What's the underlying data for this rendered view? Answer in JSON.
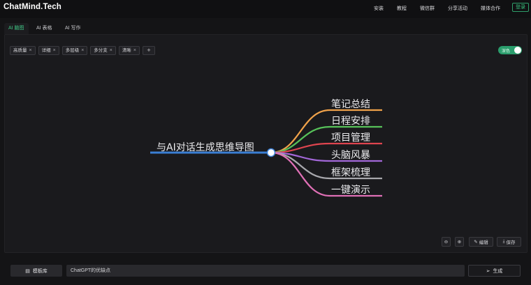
{
  "header": {
    "logo": "ChatMind.Tech",
    "nav": [
      "安装",
      "教程",
      "微信群",
      "分享活动",
      "媒体合作"
    ],
    "login_label": "登录"
  },
  "tabs": [
    {
      "label": "AI 脑图",
      "active": true
    },
    {
      "label": "AI 表格",
      "active": false
    },
    {
      "label": "AI 写作",
      "active": false
    }
  ],
  "tags": [
    "高质量",
    "详细",
    "多层级",
    "多分支",
    "清晰"
  ],
  "theme_toggle": {
    "label": "深色",
    "on": true
  },
  "mindmap": {
    "root": "与AI对话生成思维导图",
    "branches": [
      {
        "label": "笔记总结",
        "color": "#f0a24a"
      },
      {
        "label": "日程安排",
        "color": "#57c25a"
      },
      {
        "label": "项目管理",
        "color": "#e0454f"
      },
      {
        "label": "头脑风暴",
        "color": "#a267d8"
      },
      {
        "label": "框架梳理",
        "color": "#a8a8ad"
      },
      {
        "label": "一键演示",
        "color": "#e070b6"
      }
    ],
    "root_line_color": "#3b7fd4"
  },
  "controls": {
    "edit_label": "编辑",
    "save_label": "保存"
  },
  "bottom": {
    "template_label": "模板库",
    "prompt_value": "ChatGPT的优缺点",
    "generate_label": "生成"
  },
  "colors": {
    "accent": "#2a9d6c",
    "background": "#141416"
  }
}
